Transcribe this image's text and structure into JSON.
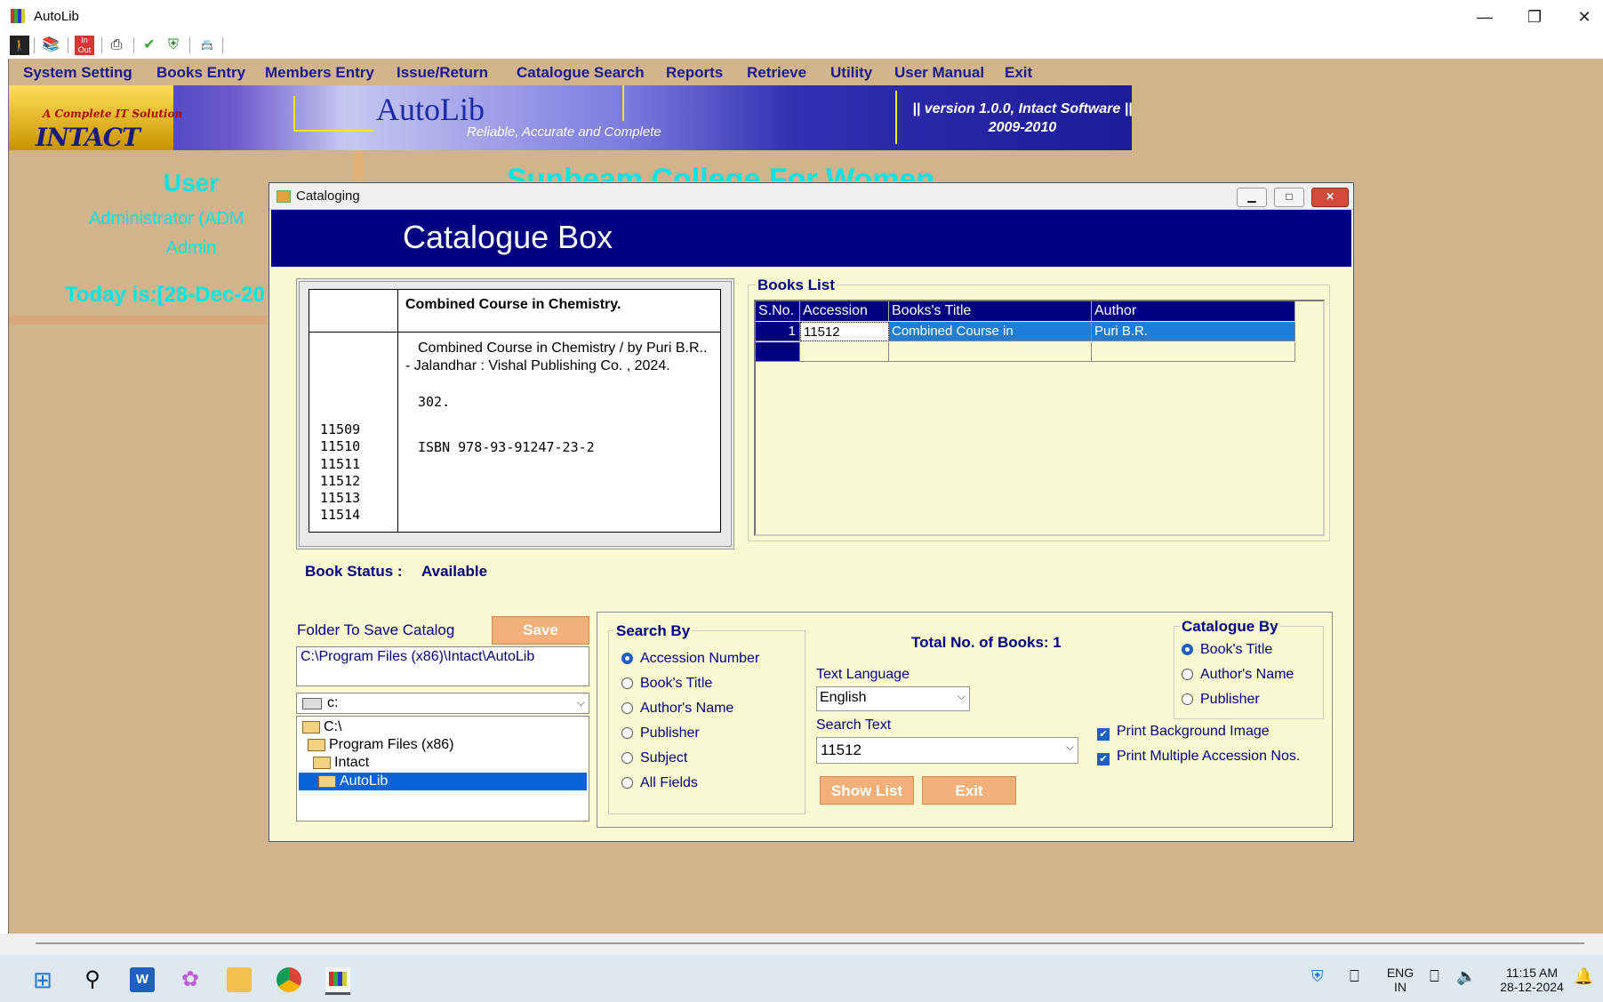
{
  "window": {
    "title": "AutoLib",
    "controls": [
      "minimize",
      "restore",
      "close"
    ]
  },
  "toolbar": {
    "icons": [
      "member-icon",
      "books-icon",
      "inout-icon",
      "print-icon",
      "check-icon",
      "shield-icon",
      "card-icon"
    ]
  },
  "menu": [
    "System Setting",
    "Books Entry",
    "Members Entry",
    "Issue/Return",
    "Catalogue Search",
    "Reports",
    "Retrieve",
    "Utility",
    "User Manual",
    "Exit"
  ],
  "banner": {
    "logo_tag": "A Complete IT Solution",
    "logo_name": "INTACT",
    "app_name": "AutoLib",
    "tagline": "Reliable, Accurate and Complete",
    "version_line1": "|| version 1.0.0, Intact Software ||",
    "version_line2": "2009-2010"
  },
  "background": {
    "user_heading": "User",
    "user_role": "Administrator (ADM",
    "user_name": "Admin",
    "today": "Today is:[28-Dec-20",
    "college": "Sunbeam College For Women"
  },
  "dialog": {
    "title": "Cataloging",
    "heading": "Catalogue Box",
    "card": {
      "title": "Combined Course in Chemistry.",
      "body": "Combined Course in Chemistry / by Puri B.R.. - Jalandhar : Vishal Publishing Co. , 2024.",
      "pages": "302.",
      "isbn": "ISBN 978-93-91247-23-2",
      "accessions": [
        "11509",
        "11510",
        "11511",
        "11512",
        "11513",
        "11514"
      ]
    },
    "books_list": {
      "legend": "Books List",
      "columns": [
        "S.No.",
        "Accession",
        "Books's Title",
        "Author"
      ],
      "rows": [
        {
          "sno": "1",
          "accession": "11512",
          "title": "Combined Course in",
          "author": "Puri B.R."
        }
      ]
    },
    "status": {
      "label": "Book Status :",
      "value": "Available"
    },
    "folder": {
      "label": "Folder To Save Catalog",
      "save_label": "Save",
      "path": "C:\\Program Files (x86)\\Intact\\AutoLib",
      "drive": "c:",
      "tree": [
        "C:\\",
        "Program Files (x86)",
        "Intact",
        "AutoLib"
      ],
      "selected": "AutoLib"
    },
    "search_by": {
      "legend": "Search By",
      "options": [
        "Accession Number",
        "Book's Title",
        "Author's Name",
        "Publisher",
        "Subject",
        "All Fields"
      ],
      "selected": "Accession Number"
    },
    "total_books": "Total No. of Books: 1",
    "text_language": {
      "label": "Text Language",
      "value": "English"
    },
    "search_text": {
      "label": "Search Text",
      "value": "11512"
    },
    "show_list_label": "Show List",
    "exit_label": "Exit",
    "catalogue_by": {
      "legend": "Catalogue By",
      "options": [
        "Book's Title",
        "Author's Name",
        "Publisher"
      ],
      "selected": "Book's Title"
    },
    "checks": [
      {
        "label": "Print Background Image",
        "checked": true
      },
      {
        "label": "Print Multiple Accession Nos.",
        "checked": true
      }
    ]
  },
  "taskbar": {
    "apps": [
      "windows-start-icon",
      "search-icon",
      "word-icon",
      "copilot-icon",
      "file-explorer-icon",
      "chrome-icon",
      "autolib-icon"
    ],
    "lang_top": "ENG",
    "lang_bottom": "IN",
    "time": "11:15 AM",
    "date": "28-12-2024"
  }
}
